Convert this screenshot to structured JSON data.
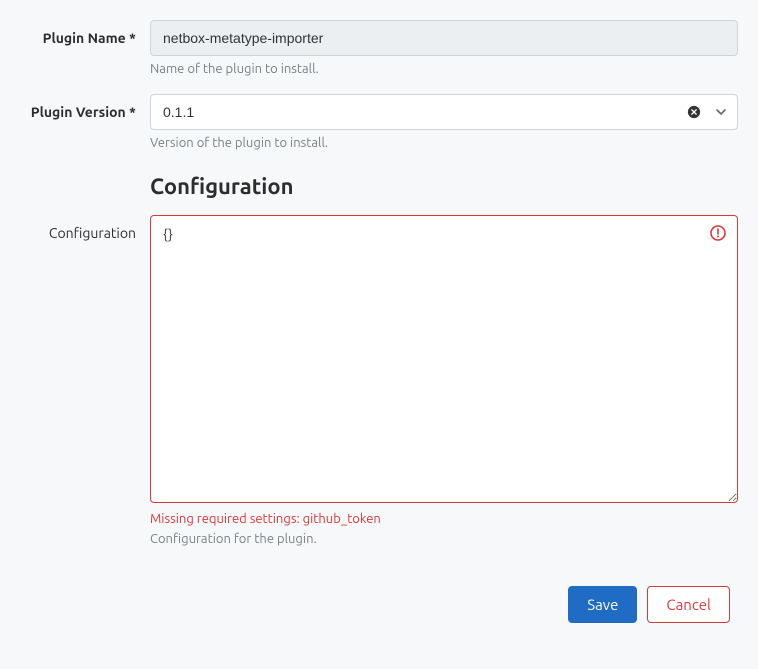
{
  "fields": {
    "plugin_name": {
      "label": "Plugin Name *",
      "value": "netbox-metatype-importer",
      "help": "Name of the plugin to install."
    },
    "plugin_version": {
      "label": "Plugin Version *",
      "value": "0.1.1",
      "help": "Version of the plugin to install."
    },
    "configuration": {
      "label": "Configuration",
      "value": "{}",
      "error": "Missing required settings: github_token",
      "help": "Configuration for the plugin."
    }
  },
  "section_header": "Configuration",
  "buttons": {
    "save": "Save",
    "cancel": "Cancel"
  }
}
